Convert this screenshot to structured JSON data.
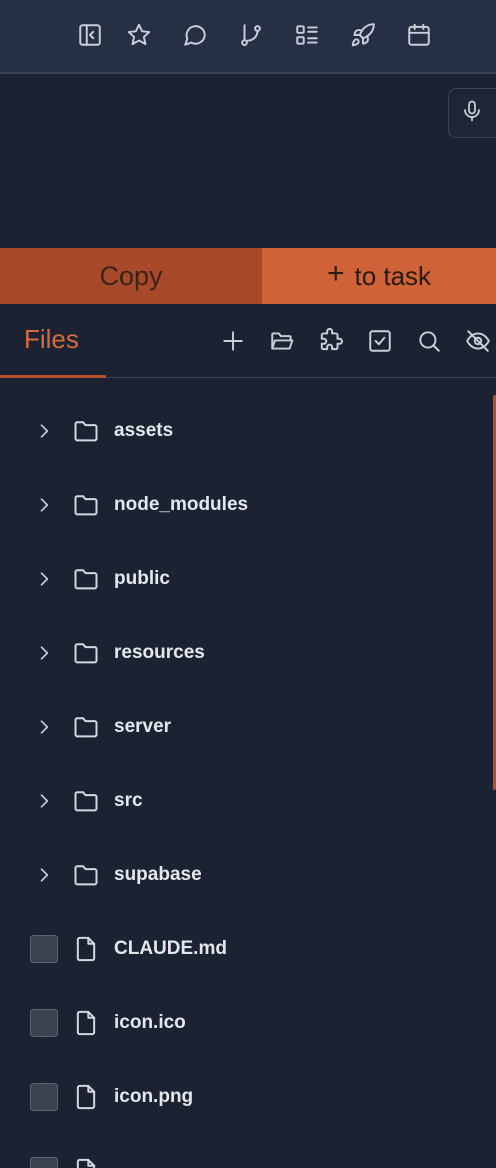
{
  "toolbar": {
    "icons": [
      "sidebar-collapse-icon",
      "star-icon",
      "chat-bubble-icon",
      "git-branch-icon",
      "list-checks-icon",
      "rocket-icon",
      "calendar-icon"
    ]
  },
  "actions": {
    "copy_label": "Copy",
    "task_plus": "+",
    "task_label": "to task"
  },
  "files_tab": {
    "label": "Files",
    "icons": [
      "plus-icon",
      "folder-open-icon",
      "puzzle-icon",
      "checkbox-icon",
      "search-icon",
      "eye-off-icon"
    ]
  },
  "tree": {
    "folders": [
      {
        "name": "assets"
      },
      {
        "name": "node_modules"
      },
      {
        "name": "public"
      },
      {
        "name": "resources"
      },
      {
        "name": "server"
      },
      {
        "name": "src"
      },
      {
        "name": "supabase"
      }
    ],
    "files": [
      {
        "name": "CLAUDE.md"
      },
      {
        "name": "icon.ico"
      },
      {
        "name": "icon.png"
      }
    ]
  },
  "colors": {
    "accent": "#cf6236",
    "accent_dark": "#a84a2a",
    "background": "#1b2232",
    "toolbar": "#253044"
  }
}
